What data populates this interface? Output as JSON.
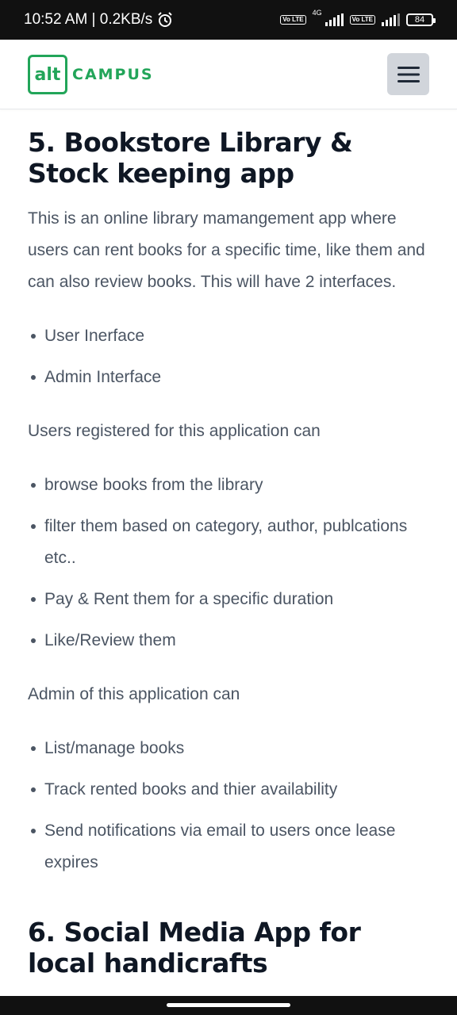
{
  "status_bar": {
    "time_speed": "10:52 AM | 0.2KB/s",
    "net1": "Vo LTE",
    "net_type": "4G",
    "net2": "Vo LTE",
    "battery": "84"
  },
  "header": {
    "logo_mark": "alt",
    "logo_text": "CAMPUS",
    "brand_color": "#22a559"
  },
  "article": {
    "heading5": "5. Bookstore Library & Stock keeping app",
    "intro": "This is an online library mamangement app where users can rent books for a specific time, like them and can also review books. This will have 2 interfaces.",
    "interfaces": [
      "User Inerface",
      "Admin Interface"
    ],
    "users_intro": "Users registered for this application can",
    "user_features": [
      "browse books from the library",
      "filter them based on category, author, publcations etc..",
      "Pay & Rent them for a specific duration",
      "Like/Review them"
    ],
    "admin_intro": "Admin of this application can",
    "admin_features": [
      "List/manage books",
      "Track rented books and thier availability",
      "Send notifications via email to users once lease expires"
    ],
    "heading6": "6. Social Media App for local handicrafts"
  }
}
